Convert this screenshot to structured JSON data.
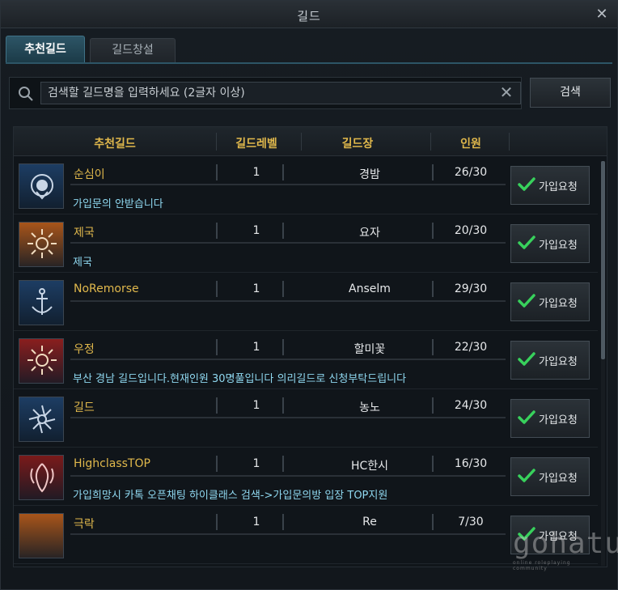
{
  "window": {
    "title": "길드",
    "close_label": "✕"
  },
  "tabs": [
    {
      "label": "추천길드",
      "active": true
    },
    {
      "label": "길드창설",
      "active": false
    }
  ],
  "search": {
    "placeholder": "검색할 길드명을 입력하세요 (2글자 이상)",
    "button_label": "검색",
    "clear_label": "✕"
  },
  "table": {
    "headers": {
      "name": "추천길드",
      "level": "길드레벨",
      "leader": "길드장",
      "members": "인원"
    },
    "join_label": "가입요청",
    "rows": [
      {
        "name": "순심이",
        "level": "1",
        "leader": "경밤",
        "members": "26/30",
        "desc": "가입문의 안받습니다",
        "emblem": "lion-emblem-icon",
        "color": "#1d3d63"
      },
      {
        "name": "제국",
        "level": "1",
        "leader": "요자",
        "members": "20/30",
        "desc": "제국",
        "emblem": "sun-emblem-icon",
        "color": "#a8551a"
      },
      {
        "name": "NoRemorse",
        "level": "1",
        "leader": "Anselm",
        "members": "29/30",
        "desc": "",
        "emblem": "anchor-emblem-icon",
        "color": "#1d3d63"
      },
      {
        "name": "우정",
        "level": "1",
        "leader": "할미꽃",
        "members": "22/30",
        "desc": "부산 경남 길드입니다.현재인원 30명풀입니다 의리길드로 신청부탁드립니다",
        "emblem": "sun-emblem-icon",
        "color": "#8a1e1e"
      },
      {
        "name": "길드",
        "level": "1",
        "leader": "농노",
        "members": "24/30",
        "desc": "",
        "emblem": "star-emblem-icon",
        "color": "#1d3d63"
      },
      {
        "name": "HighclassTOP",
        "level": "1",
        "leader": "HC한시",
        "members": "16/30",
        "desc": "가입희망시 카톡 오픈채팅 하이클래스 검색->가입문의방 입장 TOP지원",
        "emblem": "dragon-emblem-icon",
        "color": "#7a1a1a"
      },
      {
        "name": "극락",
        "level": "1",
        "leader": "Re",
        "members": "7/30",
        "desc": "",
        "emblem": "moon-emblem-icon",
        "color": "#a8551a"
      }
    ]
  },
  "scroll": {
    "position": 0.0,
    "visible_fraction": 0.49
  },
  "watermark": {
    "text": "gohatu",
    "sub": "online roleplaying community"
  },
  "colors": {
    "accent": "#e0b84c",
    "desc": "#8fd8f0",
    "tab_active": "#2d5566"
  }
}
